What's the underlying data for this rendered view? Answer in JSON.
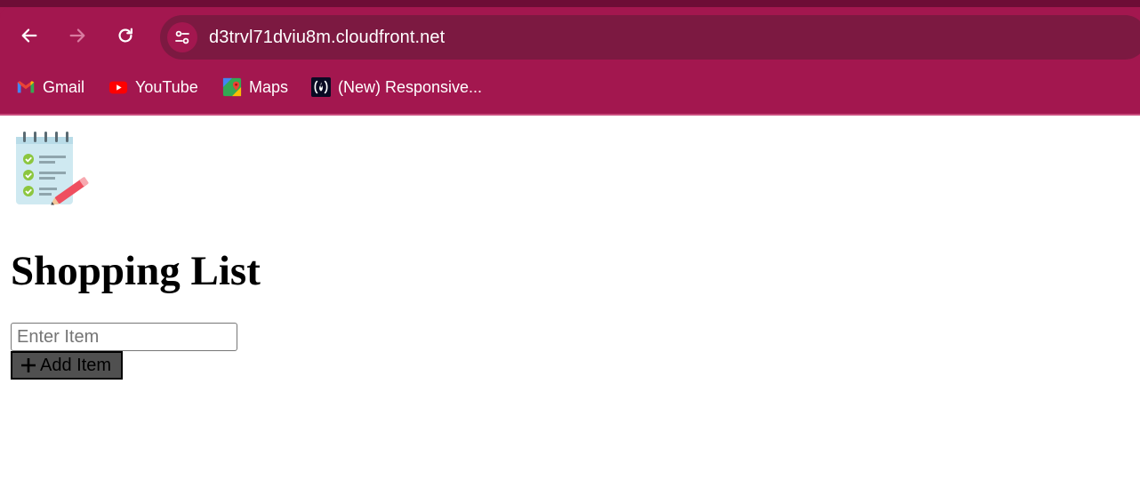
{
  "browser": {
    "url": "d3trvl71dviu8m.cloudfront.net",
    "bookmarks": [
      {
        "label": "Gmail",
        "icon": "gmail-icon"
      },
      {
        "label": "YouTube",
        "icon": "youtube-icon"
      },
      {
        "label": "Maps",
        "icon": "maps-icon"
      },
      {
        "label": "(New) Responsive...",
        "icon": "freecodecamp-icon"
      }
    ],
    "colors": {
      "frame": "#a3174f",
      "omnibox": "#7c1941"
    }
  },
  "page": {
    "logo_icon": "notepad-checklist-icon",
    "title": "Shopping List",
    "input": {
      "placeholder": "Enter Item",
      "value": ""
    },
    "add_button": {
      "icon": "plus-icon",
      "label": "Add Item"
    }
  }
}
